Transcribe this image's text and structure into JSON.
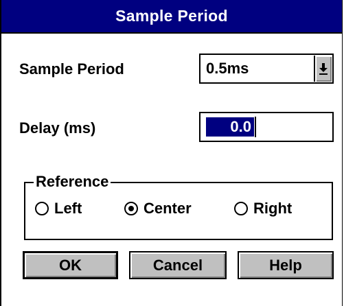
{
  "window": {
    "title": "Sample Period"
  },
  "sample_period": {
    "label": "Sample Period",
    "value": "0.5ms"
  },
  "delay": {
    "label": "Delay (ms)",
    "value": "0.0"
  },
  "reference": {
    "legend": "Reference",
    "options": [
      {
        "label": "Left",
        "checked": false
      },
      {
        "label": "Center",
        "checked": true
      },
      {
        "label": "Right",
        "checked": false
      }
    ]
  },
  "buttons": {
    "ok": "OK",
    "cancel": "Cancel",
    "help": "Help"
  },
  "colors": {
    "titlebar_bg": "#000080",
    "selection_bg": "#000080",
    "button_face": "#c0c0c0"
  },
  "icons": {
    "dropdown": "arrow-down-underline-icon"
  }
}
